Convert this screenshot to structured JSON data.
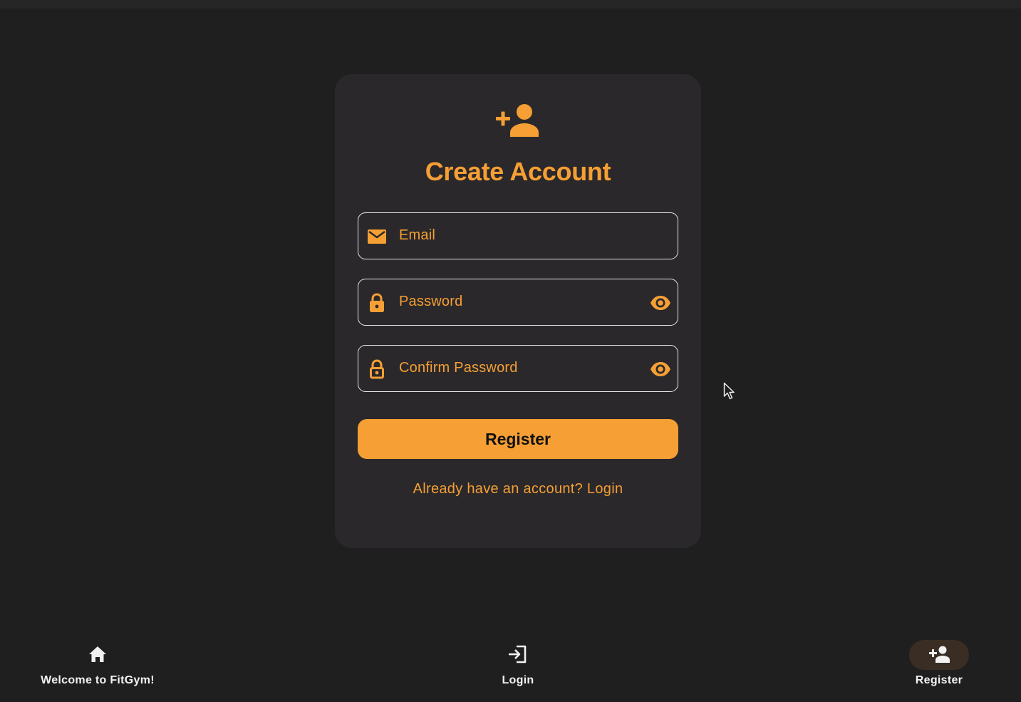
{
  "card": {
    "header_icon": "person-add-icon",
    "title": "Create Account",
    "email": {
      "placeholder": "Email",
      "icon": "mail-icon"
    },
    "password": {
      "placeholder": "Password",
      "icon": "lock-icon",
      "toggle_icon": "eye-icon"
    },
    "confirm_password": {
      "placeholder": "Confirm Password",
      "icon": "lock-outline-icon",
      "toggle_icon": "eye-icon"
    },
    "register_label": "Register",
    "login_link": "Already have an account? Login"
  },
  "nav": {
    "items": [
      {
        "label": "Welcome to FitGym!",
        "icon": "home-icon",
        "active": false
      },
      {
        "label": "Login",
        "icon": "login-icon",
        "active": false
      },
      {
        "label": "Register",
        "icon": "person-add-icon",
        "active": true
      }
    ]
  },
  "colors": {
    "accent": "#f59f34",
    "background": "#1f1f1f",
    "card": "#2a282b",
    "field_border": "#e9e7ea"
  }
}
